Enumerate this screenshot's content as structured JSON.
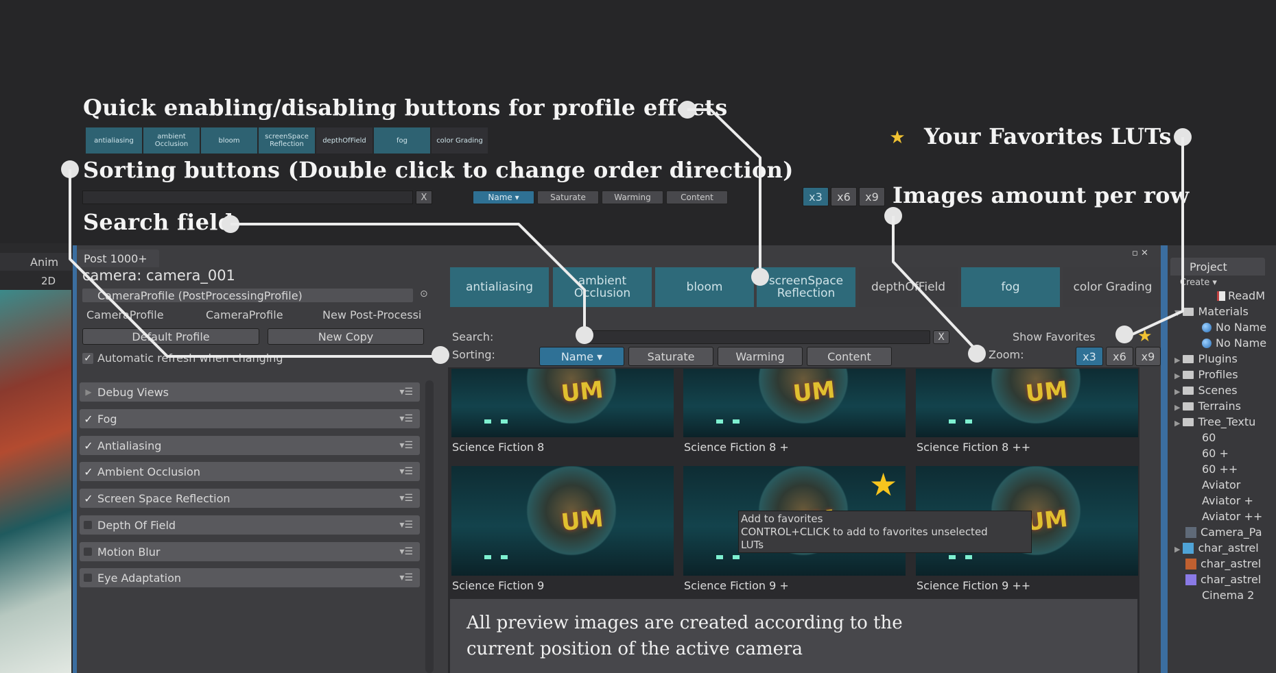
{
  "annotations": {
    "quick_buttons": "Quick enabling/disabling buttons for profile effects",
    "sorting": "Sorting buttons (Double click to change order direction)",
    "search": "Search field",
    "favorites": "Your Favorites LUTs",
    "images_per_row": "Images amount per row",
    "preview_note_line1": "All preview images are created according to the",
    "preview_note_line2": "current position of the active camera"
  },
  "mini_effects": [
    {
      "label": "antialiasing",
      "on": true
    },
    {
      "label": "ambient Occlusion",
      "on": true
    },
    {
      "label": "bloom",
      "on": true
    },
    {
      "label": "screenSpace Reflection",
      "on": true
    },
    {
      "label": "depthOfField",
      "on": false
    },
    {
      "label": "fog",
      "on": true
    },
    {
      "label": "color Grading",
      "on": false
    }
  ],
  "mini_sort": [
    "Name ▾",
    "Saturate",
    "Warming",
    "Content"
  ],
  "mini_zoom": [
    "x3",
    "x6",
    "x9"
  ],
  "mini_clear": "X",
  "window": {
    "tab_title": "Post 1000+",
    "left_tab": "Anim",
    "left_2d": "2D",
    "camera_title": "camera: camera_001",
    "profile_field": "CameraProfile (PostProcessingProfile)",
    "profile_links": [
      "CameraProfile",
      "CameraProfile",
      "New Post-Processi"
    ],
    "default_profile": "Default Profile",
    "new_copy": "New Copy",
    "auto_refresh": "Automatic refresh when changing"
  },
  "effects_bar": [
    {
      "label": "antialiasing",
      "on": true
    },
    {
      "label": "ambient Occlusion",
      "on": true
    },
    {
      "label": "bloom",
      "on": true
    },
    {
      "label": "screenSpace Reflection",
      "on": true
    },
    {
      "label": "depthOfField",
      "on": false
    },
    {
      "label": "fog",
      "on": true
    },
    {
      "label": "color Grading",
      "on": false
    }
  ],
  "search_label": "Search:",
  "sorting_label": "Sorting:",
  "search_clear": "X",
  "show_favorites": "Show Favorites",
  "zoom_label": "Zoom:",
  "sort_buttons": [
    "Name ▾",
    "Saturate",
    "Warming",
    "Content"
  ],
  "zoom_buttons": [
    "x3",
    "x6",
    "x9"
  ],
  "effect_list": [
    {
      "label": "Debug Views",
      "state": "collapsed"
    },
    {
      "label": "Fog",
      "state": "on"
    },
    {
      "label": "Antialiasing",
      "state": "on"
    },
    {
      "label": "Ambient Occlusion",
      "state": "on"
    },
    {
      "label": "Screen Space Reflection",
      "state": "on"
    },
    {
      "label": "Depth Of Field",
      "state": "off"
    },
    {
      "label": "Motion Blur",
      "state": "off"
    },
    {
      "label": "Eye Adaptation",
      "state": "off"
    }
  ],
  "thumbnails": [
    "Science Fiction 8",
    "Science Fiction 8 +",
    "Science Fiction 8 ++",
    "Science Fiction 9",
    "Science Fiction 9 +",
    "Science Fiction 9 ++"
  ],
  "thumb_logo": "UM",
  "tooltip": {
    "line1": "Add to favorites",
    "line2": "CONTROL+CLICK to add to favorites unselected",
    "line3": "LUTs"
  },
  "project": {
    "title": "Project",
    "create": "Create ▾",
    "items": [
      "ReadM",
      "Materials",
      "No Name",
      "No Name",
      "Plugins",
      "Profiles",
      "Scenes",
      "Terrains",
      "Tree_Textu",
      "60",
      "60 +",
      "60 ++",
      "Aviator",
      "Aviator +",
      "Aviator ++",
      "Camera_Pa",
      "char_astrel",
      "char_astrel",
      "char_astrel",
      "Cinema 2"
    ]
  },
  "colors": {
    "accent": "#2e6a7a",
    "selected": "#2f7196",
    "background": "#262628",
    "panel": "#3d3d40"
  }
}
